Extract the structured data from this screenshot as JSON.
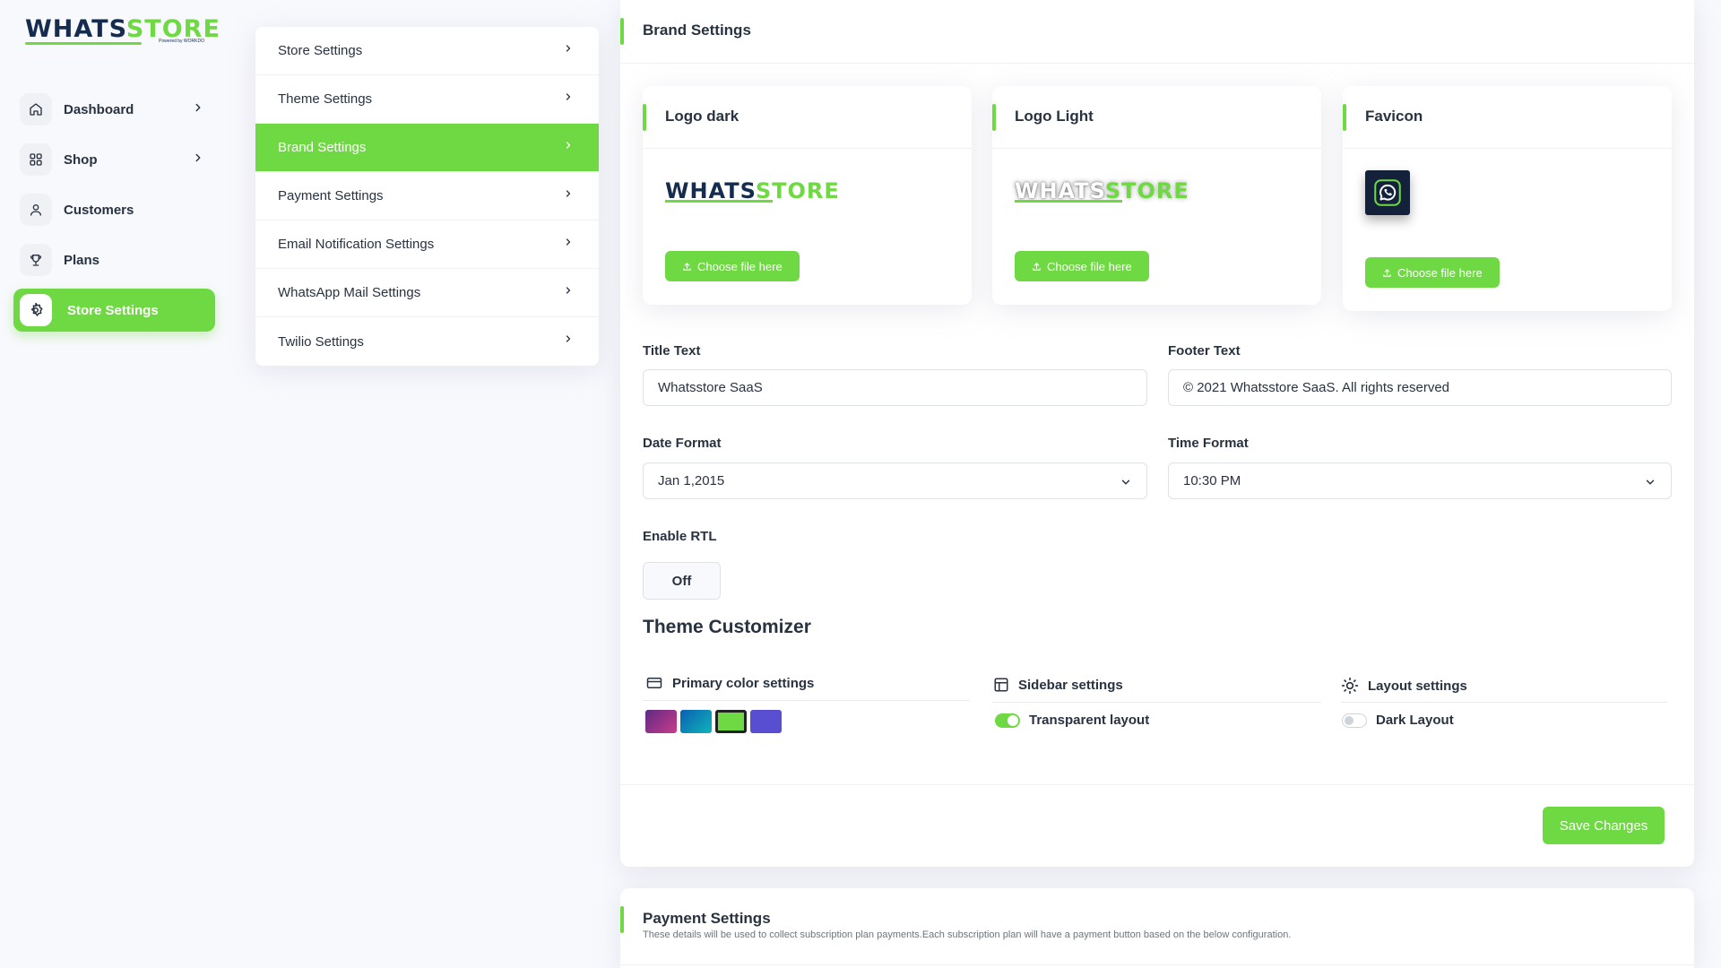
{
  "brand": {
    "logo_part1": "WHATS",
    "logo_part2": "STORE",
    "logo_sub": "Powered by WORKDO"
  },
  "sidebar": {
    "items": [
      {
        "label": "Dashboard",
        "icon": "home-icon",
        "has_chevron": true
      },
      {
        "label": "Shop",
        "icon": "grid-icon",
        "has_chevron": true
      },
      {
        "label": "Customers",
        "icon": "user-icon",
        "has_chevron": false
      },
      {
        "label": "Plans",
        "icon": "trophy-icon",
        "has_chevron": false
      },
      {
        "label": "Store Settings",
        "icon": "gear-icon",
        "has_chevron": false,
        "active": true
      }
    ]
  },
  "settings_menu": {
    "items": [
      {
        "label": "Store Settings"
      },
      {
        "label": "Theme Settings"
      },
      {
        "label": "Brand Settings",
        "active": true
      },
      {
        "label": "Payment Settings"
      },
      {
        "label": "Email Notification Settings"
      },
      {
        "label": "WhatsApp Mail Settings"
      },
      {
        "label": "Twilio Settings"
      }
    ]
  },
  "brand_settings": {
    "title": "Brand Settings",
    "logo_cards": [
      {
        "title": "Logo dark",
        "button": "Choose file here"
      },
      {
        "title": "Logo Light",
        "button": "Choose file here"
      },
      {
        "title": "Favicon",
        "button": "Choose file here"
      }
    ],
    "title_text": {
      "label": "Title Text",
      "value": "Whatsstore SaaS"
    },
    "footer_text": {
      "label": "Footer Text",
      "value": "© 2021 Whatsstore SaaS. All rights reserved"
    },
    "date_format": {
      "label": "Date Format",
      "value": "Jan 1,2015"
    },
    "time_format": {
      "label": "Time Format",
      "value": "10:30 PM"
    },
    "rtl": {
      "label": "Enable RTL",
      "value": "Off"
    },
    "theme_customizer": {
      "title": "Theme Customizer",
      "primary_color": {
        "label": "Primary color settings",
        "selected_index": 2
      },
      "sidebar": {
        "label": "Sidebar settings",
        "toggle_label": "Transparent layout",
        "enabled": true
      },
      "layout": {
        "label": "Layout settings",
        "toggle_label": "Dark Layout",
        "enabled": false
      }
    },
    "save_label": "Save Changes"
  },
  "payment_settings": {
    "title": "Payment Settings",
    "description": "These details will be used to collect subscription plan payments.Each subscription plan will have a payment button based on the below configuration."
  },
  "colors": {
    "accent": "#6fd943",
    "text": "#293240",
    "swatches": [
      "linear-gradient(135deg,#5e2a84,#c93c8a)",
      "linear-gradient(135deg,#0a5fb4,#10b5b9)",
      "#6fd943",
      "#584ed2"
    ]
  }
}
